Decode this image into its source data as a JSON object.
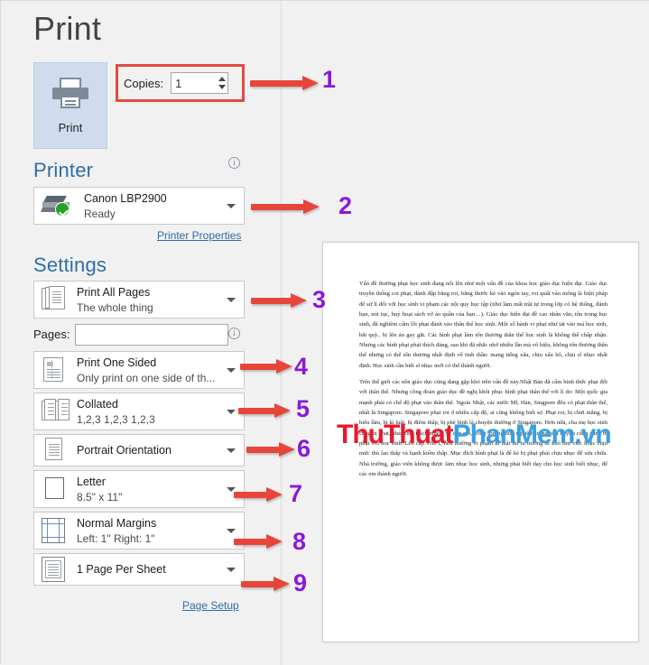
{
  "header": {
    "title": "Print"
  },
  "print_button": {
    "label": "Print",
    "icon": "printer-icon"
  },
  "copies": {
    "label": "Copies:",
    "value": "1",
    "placeholder": "",
    "highlight_color": "#e34b3f"
  },
  "printer_section": {
    "heading": "Printer",
    "info_icon": "info-icon",
    "selected": {
      "name": "Canon LBP2900",
      "status": "Ready",
      "icon": "printer-status-icon"
    },
    "properties_link": "Printer Properties"
  },
  "settings_section": {
    "heading": "Settings",
    "pages_label": "Pages:",
    "pages_value": "",
    "pages_placeholder": "",
    "page_setup_link": "Page Setup",
    "items": [
      {
        "title": "Print All Pages",
        "sub": "The whole thing",
        "icon": "pages-stack-icon"
      },
      {
        "title": "Print One Sided",
        "sub": "Only print on one side of th...",
        "icon": "one-sided-icon"
      },
      {
        "title": "Collated",
        "sub": "1,2,3   1,2,3   1,2,3",
        "icon": "collated-icon"
      },
      {
        "title": "Portrait Orientation",
        "sub": "",
        "icon": "portrait-icon"
      },
      {
        "title": "Letter",
        "sub": "8.5\" x 11\"",
        "icon": "paper-size-icon"
      },
      {
        "title": "Normal Margins",
        "sub": "Left:  1\"   Right:  1\"",
        "icon": "margins-icon"
      },
      {
        "title": "1 Page Per Sheet",
        "sub": "",
        "icon": "pages-per-sheet-icon"
      }
    ]
  },
  "preview": {
    "watermark": {
      "part1": "ThuThuat",
      "part2": "PhanMem",
      "part3": ".vn",
      "color1": "#e8192c",
      "color2": "#3aa0e0",
      "color3": "#3aa0e0"
    },
    "paragraphs": [
      "Vấn đề thưởng phạt học sinh đang nổi lên như một vấn đề của khoa học giáo dục hiện đại. Giáo dục truyền thống coi phạt, đánh đập bằng roi, bằng thước kẻ vào ngón tay, roi quất vào mông là biện pháp để sử lí đối với học sinh vi phạm các nội quy học tập (như làm mất trật tự trong lớp có hệ thống, đánh bạn, nói tục, huỷ hoại sách vở áo quần của bạn…). Giáo dục hiện đại đề cao nhân văn, tôn trọng học sinh, đã nghiêm cấm lối phạt đánh vào thân thể học sinh. Một số hành vi phạt như tát vào má học sinh, bắt quỳ.. bị lên án gay gắt. Các hình phạt làm tổn thương thân thể học sinh là không thể chấp nhận. Nhưng các hình phạt phải thích đáng, sau khi đã nhắc nhở nhiều lần mà vô hiệu, không tổn thương thân thể nhưng có thể tổn thương nhất định về tinh thần: mang tiếng xấu, chịu xấu hổ, chịu sĩ nhục nhất định. Học sinh cần biết sĩ nhục mới có thể thành người.",
      "Trên thế giới các nền giáo dục cũng đang gặp khó trên vấn đề này.Nhật Bản đã cấm hình thức phạt đối với thân thể. Nhưng công đoàn giáo dục đề nghị khôi phục hình phạt thân thể với lí do: Một quốc gia mạnh phải có chế độ phạt vào thân thể. Ngoài Nhật, các nước Mĩ, Hàn, Singpore đều có phạt thân thể, nhất là Singapore. Singapore phạt roi ở nhiều cấp độ, ai cũng không biết sợ. Phạt roi, bị chửi mắng, bị hiểu lầm, bị kỉ luật, bị điểm thấp, bị phê bình là chuyện thường ở Singapore. Hơn nữa, cha mẹ học sinh cũng bị phạt, phải chịu trách nhiệm về con em, trong trường hợp nghiêm trọng phụ huynh cũng cùng bị phạt với học sinh. Lên cấp THPT, nếu thường vi phạm kỉ luật thì ra trường sẽ khó tìm việc hoặc chịu mức thù lao thấp và hạnh kiểm thấp. Mục đích hình phạt là để kẻ bị phạt phải chịu nhục để sửa chữa. Nhà trường, giáo viên không được làm nhục học sinh, nhưng phải biết dạy cho học sinh biết nhục, để các em thành người."
    ]
  },
  "annotations": {
    "arrow_color": "#e8453a",
    "number_color": "#8b18d8",
    "callouts": [
      {
        "number": "1"
      },
      {
        "number": "2"
      },
      {
        "number": "3"
      },
      {
        "number": "4"
      },
      {
        "number": "5"
      },
      {
        "number": "6"
      },
      {
        "number": "7"
      },
      {
        "number": "8"
      },
      {
        "number": "9"
      }
    ]
  }
}
